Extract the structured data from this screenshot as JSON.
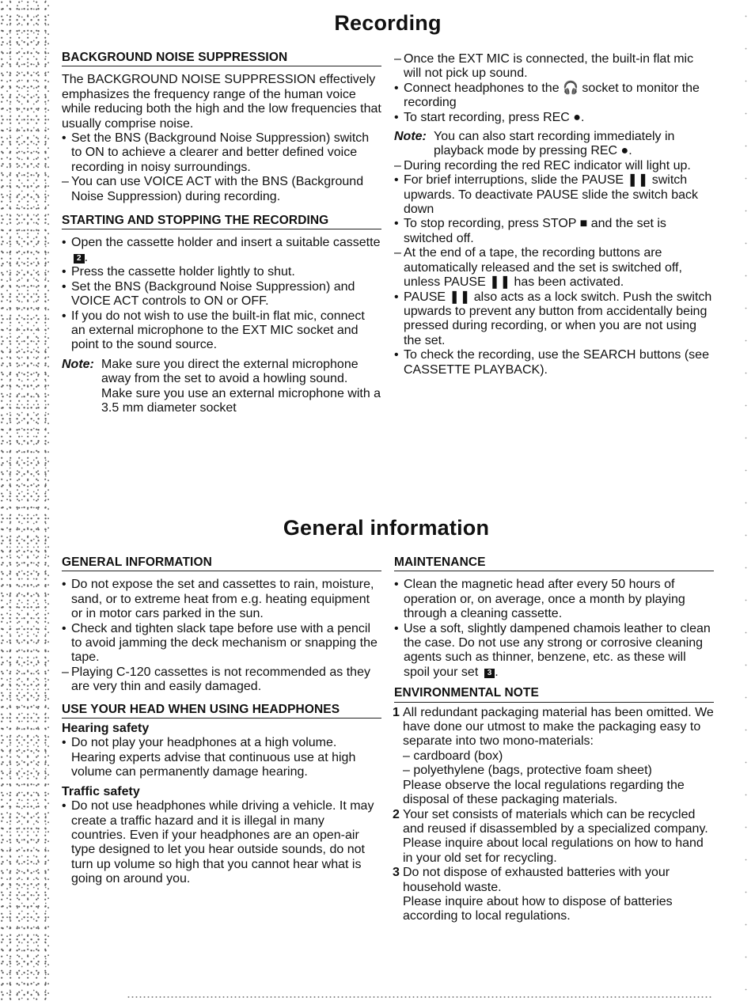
{
  "recording": {
    "title": "Recording",
    "bns": {
      "heading": "BACKGROUND NOISE SUPPRESSION",
      "intro": "The BACKGROUND NOISE SUPPRESSION effectively emphasizes the frequency range of the human voice while reducing both the high and the low frequencies that usually comprise noise.",
      "items": [
        {
          "marker": "•",
          "text": "Set the BNS (Background Noise Suppression) switch to ON to achieve a clearer and better defined voice recording in noisy surroundings."
        },
        {
          "marker": "–",
          "text": "You can use VOICE ACT with the BNS (Background Noise Suppression) during recording."
        }
      ]
    },
    "start_stop": {
      "heading": "STARTING AND STOPPING THE RECORDING",
      "items": [
        {
          "marker": "•",
          "text": "Open the cassette holder and insert a suitable cassette",
          "figure_ref": "2",
          "suffix": "."
        },
        {
          "marker": "•",
          "text": "Press the cassette holder lightly to shut."
        },
        {
          "marker": "•",
          "text": "Set the BNS (Background Noise Suppression) and VOICE ACT controls to ON or OFF."
        },
        {
          "marker": "•",
          "text": "If you do not wish to use the built-in flat mic, connect an external microphone to the EXT MIC socket and point to the sound source."
        }
      ],
      "note_label": "Note:",
      "note_lines": [
        "Make sure you direct the external microphone away from the set to avoid a howling sound.",
        "Make sure you use an external microphone with a 3.5 mm diameter socket"
      ]
    },
    "right_column": {
      "items_a": [
        {
          "marker": "–",
          "text": "Once the EXT MIC is connected, the built-in flat mic will not pick up sound."
        },
        {
          "marker": "•",
          "text": "Connect headphones to the 🎧 socket to monitor the recording"
        },
        {
          "marker": "•",
          "text": "To start recording, press REC ●."
        }
      ],
      "note_label": "Note:",
      "note_text": "You can also start recording immediately in playback mode by pressing REC ●.",
      "items_b": [
        {
          "marker": "–",
          "text": "During recording the red REC indicator will light up."
        },
        {
          "marker": "•",
          "text": "For brief interruptions, slide the PAUSE ❚❚ switch upwards. To deactivate PAUSE slide the switch back down"
        },
        {
          "marker": "•",
          "text": "To stop recording, press STOP ■ and the set is switched off."
        },
        {
          "marker": "–",
          "text": "At the end of a tape, the recording buttons are automatically released and the set is switched off, unless PAUSE ❚❚ has been activated."
        },
        {
          "marker": "•",
          "text": "PAUSE ❚❚ also acts as a lock switch. Push the switch upwards to prevent any button from accidentally being pressed during recording, or when you are not using the set."
        },
        {
          "marker": "•",
          "text": "To check the recording, use the SEARCH buttons (see CASSETTE PLAYBACK)."
        }
      ]
    }
  },
  "general": {
    "title": "General information",
    "general_info": {
      "heading": "GENERAL INFORMATION",
      "items": [
        {
          "marker": "•",
          "text": "Do not expose the set and cassettes to rain, moisture, sand, or to extreme heat from e.g. heating equipment or in motor cars parked in the sun."
        },
        {
          "marker": "•",
          "text": "Check and tighten slack tape before use with a pencil to avoid jamming the deck mechanism or snapping the tape."
        },
        {
          "marker": "–",
          "text": "Playing C-120 cassettes is not recommended as they are very thin and easily damaged."
        }
      ]
    },
    "headphones": {
      "heading": "USE YOUR HEAD WHEN USING HEADPHONES",
      "hearing_title": "Hearing safety",
      "hearing_items": [
        {
          "marker": "•",
          "text": "Do not play your headphones at a high volume. Hearing experts advise that continuous use at high volume can permanently damage hearing."
        }
      ],
      "traffic_title": "Traffic safety",
      "traffic_items": [
        {
          "marker": "•",
          "text": "Do not use headphones while driving a vehicle. It may create a traffic hazard and it is illegal in many countries. Even if your headphones are an open-air type designed to let you hear outside sounds, do not turn up volume so high that you cannot hear what is going on around you."
        }
      ]
    },
    "maintenance": {
      "heading": "MAINTENANCE",
      "items": [
        {
          "marker": "•",
          "text": "Clean the magnetic head after every 50  hours of operation or, on average, once a month by playing through a cleaning cassette."
        },
        {
          "marker": "•",
          "text": "Use a soft, slightly dampened chamois leather to clean the case. Do not use any strong or corrosive cleaning agents such as thinner, benzene, etc. as these will spoil your set",
          "figure_ref": "3",
          "suffix": "."
        }
      ]
    },
    "environmental": {
      "heading": "ENVIRONMENTAL NOTE",
      "points": [
        {
          "number": "1",
          "lines": [
            "All redundant packaging material has been omitted. We have done our utmost to make the packaging easy to separate into two mono-materials:",
            "– cardboard (box)",
            "– polyethylene (bags, protective foam sheet)",
            "Please observe the local regulations regarding the disposal of these packaging materials."
          ]
        },
        {
          "number": "2",
          "lines": [
            "Your set consists of materials which can be recycled and reused if disassembled by a specialized company. Please inquire about local regulations on how to hand in your old set for recycling."
          ]
        },
        {
          "number": "3",
          "lines": [
            "Do not dispose of exhausted batteries with your household waste.",
            "Please inquire about how to dispose of batteries according to local regulations."
          ]
        }
      ]
    }
  }
}
